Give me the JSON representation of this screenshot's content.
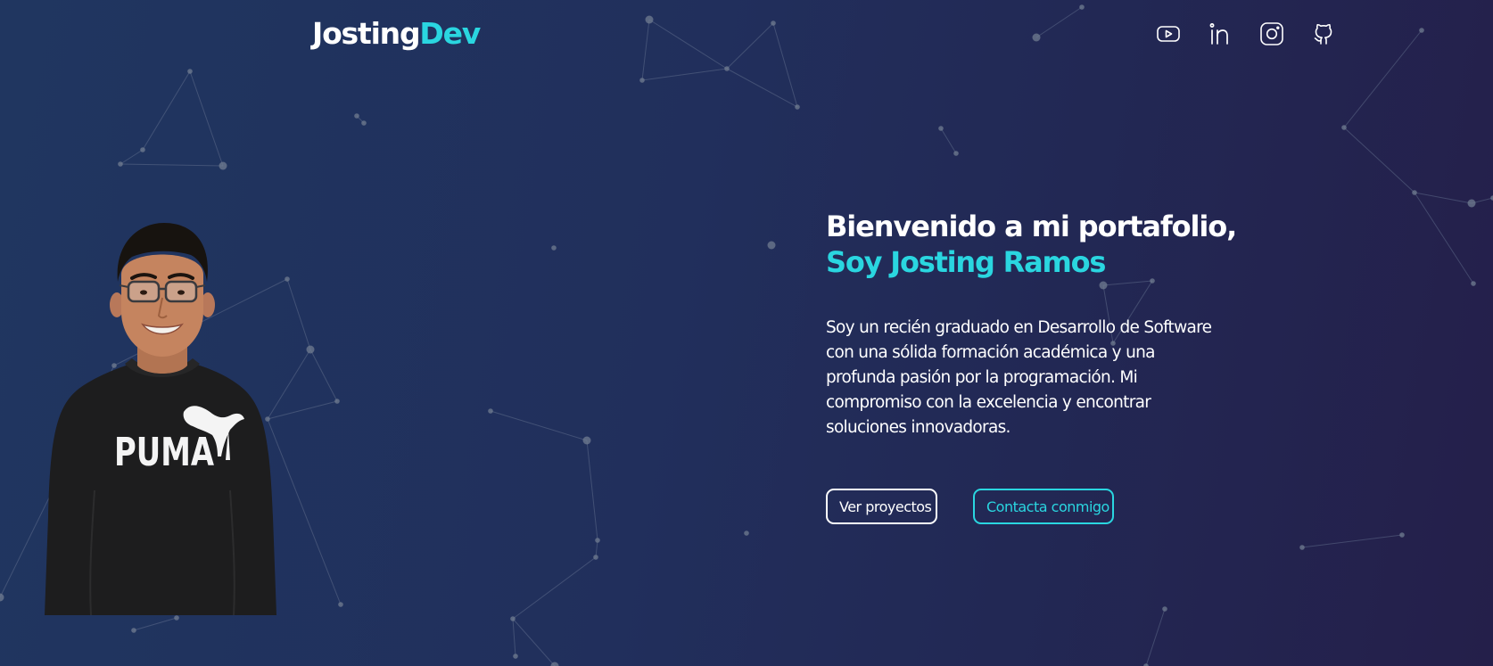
{
  "header": {
    "logo_main": "Josting",
    "logo_accent": "Dev",
    "social_icons": [
      "youtube-icon",
      "linkedin-icon",
      "instagram-icon",
      "github-icon"
    ]
  },
  "hero": {
    "greeting": "Bienvenido a mi portafolio,",
    "name": "Soy Josting Ramos",
    "bio_lines": [
      "Soy un recién graduado en Desarrollo de Software",
      "con una sólida formación académica y una",
      "profunda pasión por la programación. Mi",
      "compromiso con la excelencia y encontrar",
      "soluciones innovadoras."
    ],
    "primary_button": "Ver proyectos",
    "secondary_button": "Contacta conmigo"
  },
  "portrait": {
    "shirt_text": "PUMA"
  },
  "colors": {
    "accent": "#2ad6e0",
    "background_start": "#203660",
    "background_end": "#241f4a",
    "text": "#ffffff"
  }
}
